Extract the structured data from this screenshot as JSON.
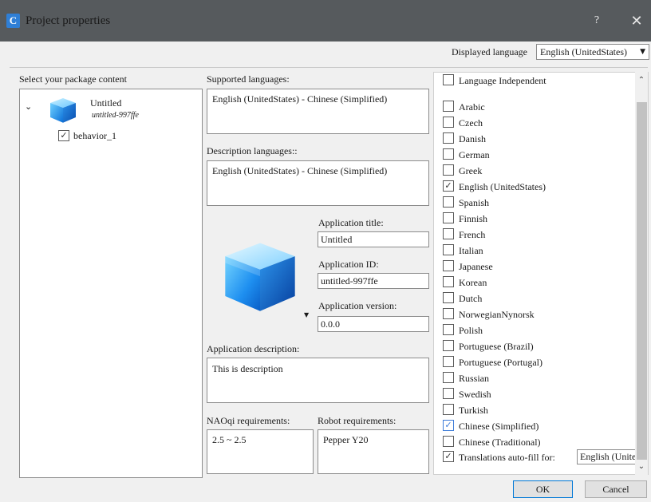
{
  "window": {
    "title": "Project properties",
    "app_icon_letter": "C",
    "help_label": "?",
    "close_label": "✕"
  },
  "displayed_language": {
    "label": "Displayed language",
    "value": "English (UnitedStates)"
  },
  "package": {
    "header": "Select your package content",
    "project_name": "Untitled",
    "project_id": "untitled-997ffe",
    "behavior": "behavior_1",
    "behavior_checked": true
  },
  "supported_languages": {
    "label": "Supported languages:",
    "value": "English (UnitedStates) - Chinese (Simplified)"
  },
  "description_languages": {
    "label": "Description languages::",
    "value": "English (UnitedStates) - Chinese (Simplified)"
  },
  "application": {
    "title_label": "Application title:",
    "title_value": "Untitled",
    "id_label": "Application ID:",
    "id_value": "untitled-997ffe",
    "version_label": "Application version:",
    "version_value": "0.0.0",
    "description_label": "Application description:",
    "description_value": "This is description"
  },
  "requirements": {
    "naoqi_label": "NAOqi requirements:",
    "naoqi_value": "2.5 ~ 2.5",
    "robot_label": "Robot requirements:",
    "robot_value": "Pepper Y20"
  },
  "languages": {
    "independent": "Language Independent",
    "list": [
      {
        "label": "Arabic",
        "checked": false
      },
      {
        "label": "Czech",
        "checked": false
      },
      {
        "label": "Danish",
        "checked": false
      },
      {
        "label": "German",
        "checked": false
      },
      {
        "label": "Greek",
        "checked": false
      },
      {
        "label": "English (UnitedStates)",
        "checked": true
      },
      {
        "label": "Spanish",
        "checked": false
      },
      {
        "label": "Finnish",
        "checked": false
      },
      {
        "label": "French",
        "checked": false
      },
      {
        "label": "Italian",
        "checked": false
      },
      {
        "label": "Japanese",
        "checked": false
      },
      {
        "label": "Korean",
        "checked": false
      },
      {
        "label": "Dutch",
        "checked": false
      },
      {
        "label": "NorwegianNynorsk",
        "checked": false
      },
      {
        "label": "Polish",
        "checked": false
      },
      {
        "label": "Portuguese (Brazil)",
        "checked": false
      },
      {
        "label": "Portuguese (Portugal)",
        "checked": false
      },
      {
        "label": "Russian",
        "checked": false
      },
      {
        "label": "Swedish",
        "checked": false
      },
      {
        "label": "Turkish",
        "checked": false
      },
      {
        "label": "Chinese (Simplified)",
        "checked": true
      },
      {
        "label": "Chinese (Traditional)",
        "checked": false
      }
    ],
    "autofill_label": "Translations auto-fill for:",
    "autofill_checked": true,
    "autofill_value": "English (United:"
  },
  "buttons": {
    "ok": "OK",
    "cancel": "Cancel"
  },
  "colors": {
    "titlebar": "#565a5d",
    "accent": "#0078d7",
    "check_blue": "#3d7bd8"
  }
}
